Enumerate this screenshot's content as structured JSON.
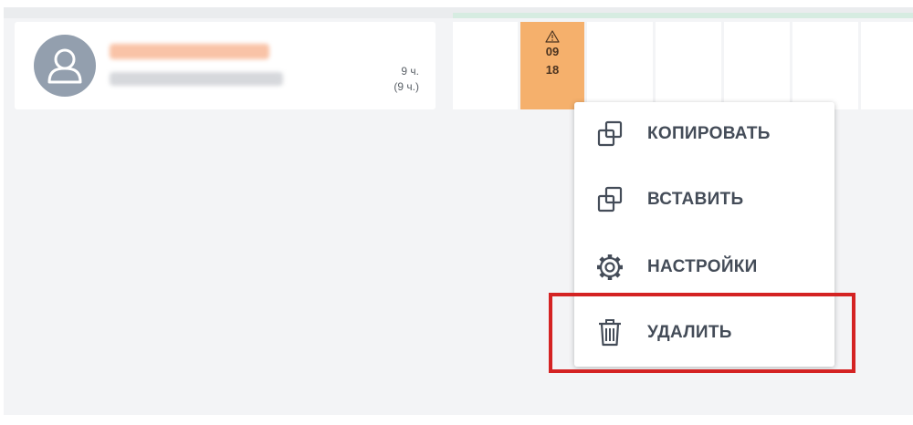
{
  "employee": {
    "hours_total": "9 ч.",
    "hours_paren": "(9 ч.)"
  },
  "shift": {
    "icon": "warning-icon",
    "start": "09",
    "end": "18",
    "color": "#f5b06c"
  },
  "context_menu": {
    "items": [
      {
        "label": "КОПИРОВАТЬ",
        "icon": "copy-icon"
      },
      {
        "label": "ВСТАВИТЬ",
        "icon": "paste-icon"
      },
      {
        "label": "НАСТРОЙКИ",
        "icon": "gear-icon"
      },
      {
        "label": "УДАЛИТЬ",
        "icon": "trash-icon"
      }
    ]
  },
  "colors": {
    "highlight": "#d42323",
    "menu_text": "#444c58",
    "avatar": "#939fae"
  }
}
